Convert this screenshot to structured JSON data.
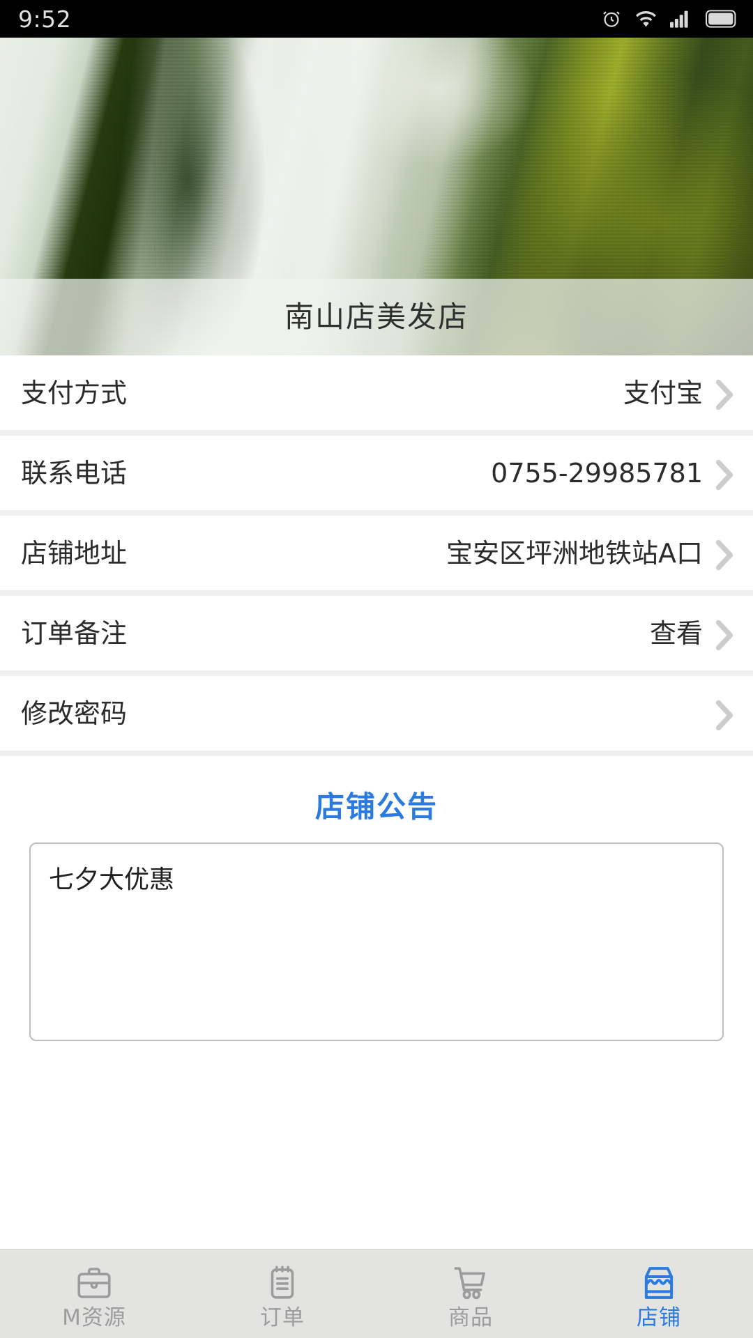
{
  "statusbar": {
    "time": "9:52",
    "icons": [
      "alarm-icon",
      "wifi-icon",
      "signal-icon",
      "battery-icon"
    ]
  },
  "banner": {
    "shop_name": "南山店美发店",
    "image": "waterfall-photo"
  },
  "info_rows": [
    {
      "label": "支付方式",
      "value": "支付宝",
      "name": "payment-method"
    },
    {
      "label": "联系电话",
      "value": "0755-29985781",
      "name": "contact-phone"
    },
    {
      "label": "店铺地址",
      "value": "宝安区坪洲地铁站A口",
      "name": "shop-address"
    },
    {
      "label": "订单备注",
      "value": "查看",
      "name": "order-remark"
    },
    {
      "label": "修改密码",
      "value": "",
      "name": "change-password"
    }
  ],
  "notice": {
    "title": "店铺公告",
    "content": "七夕大优惠",
    "placeholder": ""
  },
  "tabbar": {
    "items": [
      {
        "label": "M资源",
        "icon": "briefcase-icon",
        "active": false
      },
      {
        "label": "订单",
        "icon": "clipboard-icon",
        "active": false
      },
      {
        "label": "商品",
        "icon": "cart-icon",
        "active": false
      },
      {
        "label": "店铺",
        "icon": "store-icon",
        "active": true
      }
    ]
  },
  "colors": {
    "accent": "#2a7ae0",
    "inactive": "#9c9c9c",
    "separator": "#f0f0f0",
    "tabbar_bg": "#e3e3e2",
    "chevron": "#cccccc"
  }
}
